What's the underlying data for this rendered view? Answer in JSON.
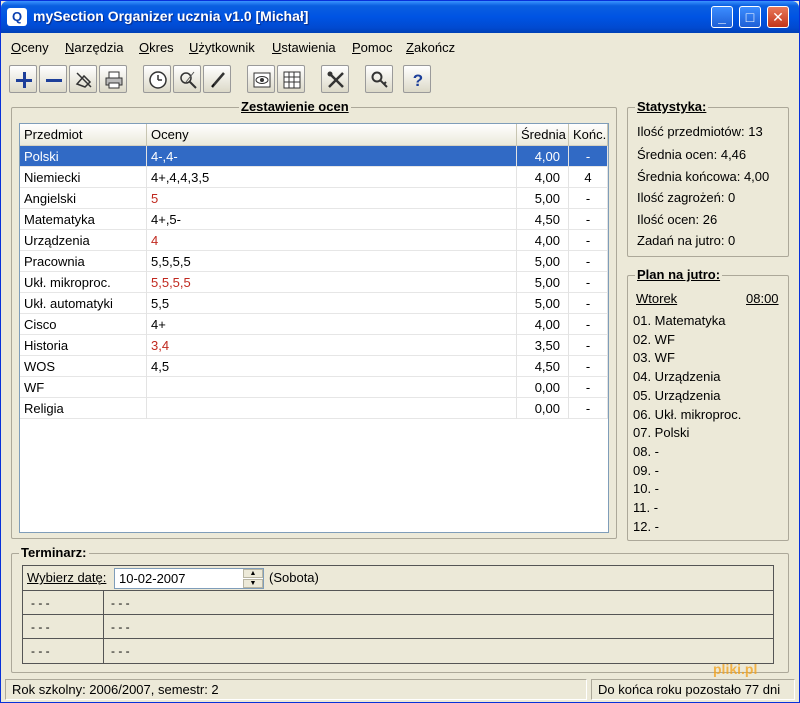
{
  "window": {
    "app_icon": "Q",
    "title": "mySection Organizer ucznia v1.0 [Michał]",
    "controls": {
      "minimize": "_",
      "maximize": "□",
      "close": "✕"
    }
  },
  "menu": [
    "Oceny",
    "Narzędzia",
    "Okres",
    "Użytkownik",
    "Ustawienia",
    "Pomoc",
    "Zakończ"
  ],
  "toolbar": {
    "icons": [
      "add-icon",
      "remove-icon",
      "clear-icon",
      "print-icon",
      "clock-icon",
      "search-edit-icon",
      "pencil-icon",
      "eye-icon",
      "table-icon",
      "tools-icon",
      "key-icon",
      "help-icon"
    ],
    "help_glyph": "?"
  },
  "grades": {
    "title": "Zestawienie ocen",
    "columns": {
      "subject": "Przedmiot",
      "grades": "Oceny",
      "average": "Średnia",
      "final": "Końc."
    },
    "rows": [
      {
        "subject": "Polski",
        "grades": "4-,4-",
        "average": "4,00",
        "final": "-",
        "alert": false,
        "selected": true
      },
      {
        "subject": "Niemiecki",
        "grades": "4+,4,4,3,5",
        "average": "4,00",
        "final": "4",
        "alert": false
      },
      {
        "subject": "Angielski",
        "grades": "5",
        "average": "5,00",
        "final": "-",
        "alert": true
      },
      {
        "subject": "Matematyka",
        "grades": "4+,5-",
        "average": "4,50",
        "final": "-",
        "alert": false
      },
      {
        "subject": "Urządzenia",
        "grades": "4",
        "average": "4,00",
        "final": "-",
        "alert": true
      },
      {
        "subject": "Pracownia",
        "grades": "5,5,5,5",
        "average": "5,00",
        "final": "-",
        "alert": false
      },
      {
        "subject": "Ukł. mikroproc.",
        "grades": "5,5,5,5",
        "average": "5,00",
        "final": "-",
        "alert": true
      },
      {
        "subject": "Ukł. automatyki",
        "grades": "5,5",
        "average": "5,00",
        "final": "-",
        "alert": false
      },
      {
        "subject": "Cisco",
        "grades": "4+",
        "average": "4,00",
        "final": "-",
        "alert": false
      },
      {
        "subject": "Historia",
        "grades": "3,4",
        "average": "3,50",
        "final": "-",
        "alert": true
      },
      {
        "subject": "WOS",
        "grades": "4,5",
        "average": "4,50",
        "final": "-",
        "alert": false
      },
      {
        "subject": "WF",
        "grades": "",
        "average": "0,00",
        "final": "-",
        "alert": false
      },
      {
        "subject": "Religia",
        "grades": "",
        "average": "0,00",
        "final": "-",
        "alert": false
      }
    ]
  },
  "stats": {
    "title": "Statystyka:",
    "lines": [
      "Ilość przedmiotów: 13",
      "Średnia ocen: 4,46",
      "Średnia końcowa: 4,00",
      "Ilość zagrożeń: 0",
      "Ilość ocen: 26",
      "Zadań na jutro: 0"
    ]
  },
  "plan": {
    "title": "Plan na jutro:",
    "day": "Wtorek",
    "time": "08:00",
    "lessons": [
      "01. Matematyka",
      "02. WF",
      "03. WF",
      "04. Urządzenia",
      "05. Urządzenia",
      "06. Ukł. mikroproc.",
      "07. Polski",
      "08. -",
      "09. -",
      "10. -",
      "11. -",
      "12. -"
    ]
  },
  "terminarz": {
    "title": "Terminarz:",
    "date_label": "Wybierz datę:",
    "date_value": "10-02-2007",
    "day_name": "(Sobota)",
    "rows": [
      {
        "col1": "- - -",
        "col2": "- - -"
      },
      {
        "col1": "- - -",
        "col2": "- - -"
      },
      {
        "col1": "- - -",
        "col2": "- - -"
      }
    ]
  },
  "status": {
    "left": "Rok szkolny: 2006/2007, semestr: 2",
    "right": "Do końca roku pozostało 77 dni"
  },
  "watermark": "pliki.pl",
  "colors": {
    "title_bar": "#0054e3",
    "selection": "#316ac5",
    "alert_grade": "#c0281e",
    "window_bg": "#ece9d8"
  }
}
